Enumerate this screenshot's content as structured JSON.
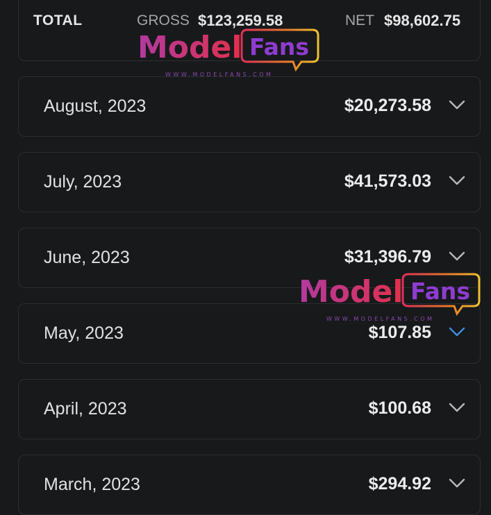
{
  "summary": {
    "total_label": "TOTAL",
    "gross_label": "GROSS",
    "gross_value": "$123,259.58",
    "net_label": "NET",
    "net_value": "$98,602.75"
  },
  "months": [
    {
      "label": "August, 2023",
      "amount": "$20,273.58",
      "expanded": false
    },
    {
      "label": "July, 2023",
      "amount": "$41,573.03",
      "expanded": false
    },
    {
      "label": "June, 2023",
      "amount": "$31,396.79",
      "expanded": false
    },
    {
      "label": "May, 2023",
      "amount": "$107.85",
      "expanded": true
    },
    {
      "label": "April, 2023",
      "amount": "$100.68",
      "expanded": false
    },
    {
      "label": "March, 2023",
      "amount": "$294.92",
      "expanded": false
    }
  ],
  "watermark": {
    "word1": "Model",
    "word2": "Fans",
    "url": "WWW.MODELFANS.COM"
  },
  "icons": {
    "chevron": "chevron-down-icon"
  },
  "colors": {
    "background": "#18191b",
    "card_border": "#2c2e31",
    "chevron": "#b9b9b9",
    "chevron_active": "#3d8fe0"
  }
}
